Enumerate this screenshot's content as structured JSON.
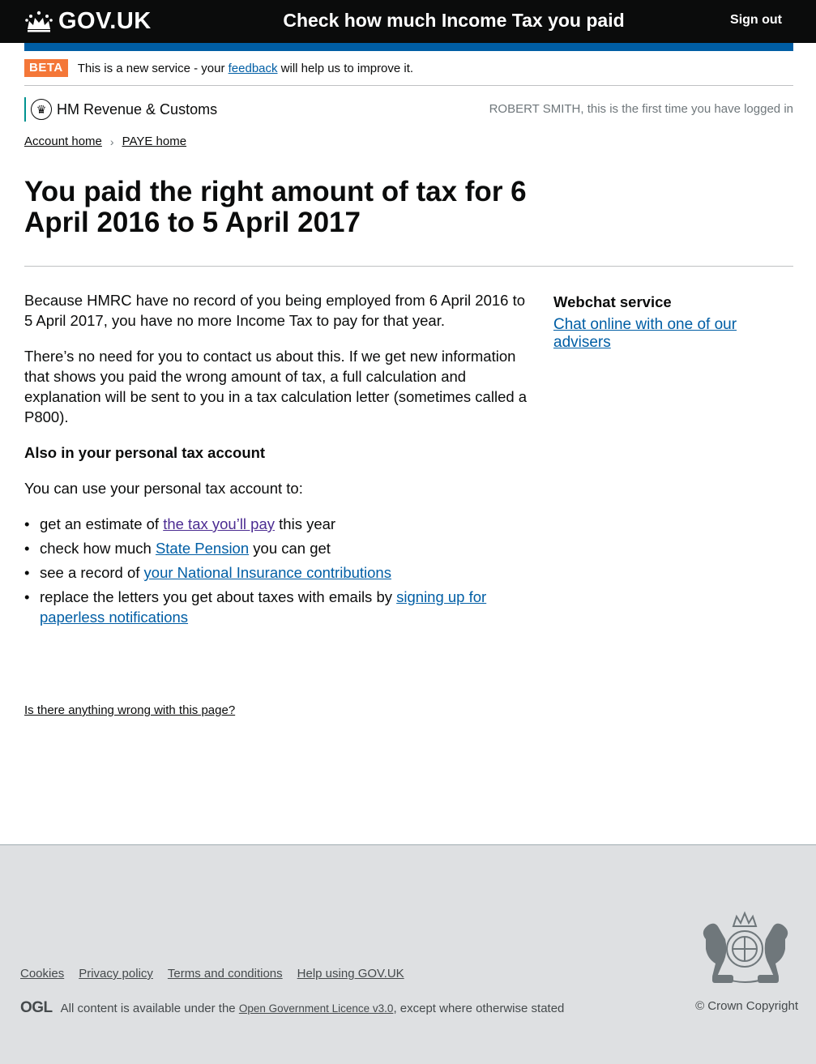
{
  "header": {
    "logo_text": "GOV.UK",
    "service_name": "Check how much Income Tax you paid",
    "sign_out": "Sign out"
  },
  "beta": {
    "tag": "BETA",
    "text_before": "This is a new service - your ",
    "link": "feedback",
    "text_after": " will help us to improve it."
  },
  "org": {
    "name": "HM Revenue & Customs",
    "login_message": "ROBERT SMITH, this is the first time you have logged in"
  },
  "breadcrumb": {
    "items": [
      "Account home",
      "PAYE home"
    ]
  },
  "page": {
    "title": "You paid the right amount of tax for 6 April 2016 to 5 April 2017",
    "para1": "Because HMRC have no record of you being employed from 6 April 2016 to 5 April 2017, you have no more Income Tax to pay for that year.",
    "para2": "There’s no need for you to contact us about this. If we get new information that shows you paid the wrong amount of tax, a full calculation and explanation will be sent to you in a tax calculation letter (sometimes called a P800).",
    "also_heading": "Also in your personal tax account",
    "intro": "You can use your personal tax account to:",
    "list": [
      {
        "before": "get an estimate of ",
        "link": "the tax you’ll pay",
        "after": " this year"
      },
      {
        "before": "check how much ",
        "link": "State Pension",
        "after": " you can get"
      },
      {
        "before": "see a record of ",
        "link": "your National Insurance contributions",
        "after": ""
      },
      {
        "before": "replace the letters you get about taxes with emails by ",
        "link": "signing up for paperless notifications",
        "after": ""
      }
    ],
    "report_link": "Is there anything wrong with this page?"
  },
  "sidebar": {
    "heading": "Webchat service",
    "link": "Chat online with one of our advisers"
  },
  "footer": {
    "links": [
      "Cookies",
      "Privacy policy",
      "Terms and conditions",
      "Help using GOV.UK"
    ],
    "ogl": "OGL",
    "licence_before": "All content is available under the ",
    "licence_link": "Open Government Licence v3.0",
    "licence_after": ", except where otherwise stated",
    "copyright": "© Crown Copyright"
  },
  "colors": {
    "header_bg": "#0b0c0c",
    "brand_blue": "#005ea5",
    "beta_orange": "#f47738",
    "link": "#005ea5",
    "visited_link": "#4c2c92",
    "footer_bg": "#dee0e2"
  }
}
